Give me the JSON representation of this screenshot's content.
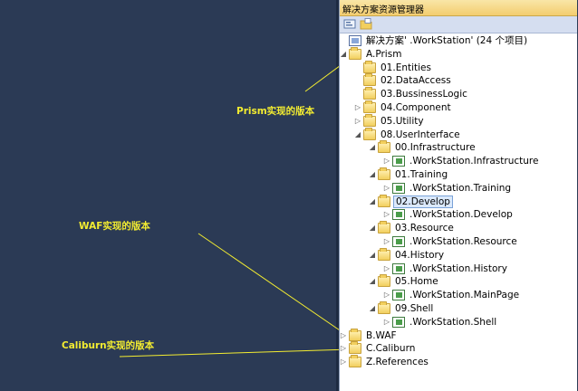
{
  "annotations": {
    "prism": "Prism实现的版本",
    "waf": "WAF实现的版本",
    "caliburn": "Caliburn实现的版本"
  },
  "panel": {
    "title": "解决方案资源管理器"
  },
  "toolbar": {
    "items": [
      "properties-icon",
      "show-all-files-icon"
    ]
  },
  "tree": [
    {
      "label": "解决方案'          .WorkStation' (24 个项目)",
      "icon": "solution-icon",
      "level": 0,
      "expander": ""
    },
    {
      "label": "A.Prism",
      "icon": "folder-icon",
      "level": 0,
      "expander": "expanded"
    },
    {
      "label": "01.Entities",
      "icon": "folder-icon",
      "level": 1,
      "expander": ""
    },
    {
      "label": "02.DataAccess",
      "icon": "folder-icon",
      "level": 1,
      "expander": ""
    },
    {
      "label": "03.BussinessLogic",
      "icon": "folder-icon",
      "level": 1,
      "expander": ""
    },
    {
      "label": "04.Component",
      "icon": "folder-icon",
      "level": 1,
      "expander": "collapsed"
    },
    {
      "label": "05.Utility",
      "icon": "folder-icon",
      "level": 1,
      "expander": "collapsed"
    },
    {
      "label": "08.UserInterface",
      "icon": "folder-icon",
      "level": 1,
      "expander": "expanded"
    },
    {
      "label": "00.Infrastructure",
      "icon": "folder-icon",
      "level": 2,
      "expander": "expanded"
    },
    {
      "label": ".WorkStation.Infrastructure",
      "icon": "project-icon",
      "level": 3,
      "expander": "collapsed"
    },
    {
      "label": "01.Training",
      "icon": "folder-icon",
      "level": 2,
      "expander": "expanded"
    },
    {
      "label": ".WorkStation.Training",
      "icon": "project-icon",
      "level": 3,
      "expander": "collapsed"
    },
    {
      "label": "02.Develop",
      "icon": "folder-icon",
      "level": 2,
      "expander": "expanded",
      "selected": true
    },
    {
      "label": ".WorkStation.Develop",
      "icon": "project-icon",
      "level": 3,
      "expander": "collapsed"
    },
    {
      "label": "03.Resource",
      "icon": "folder-icon",
      "level": 2,
      "expander": "expanded"
    },
    {
      "label": ".WorkStation.Resource",
      "icon": "project-icon",
      "level": 3,
      "expander": "collapsed"
    },
    {
      "label": "04.History",
      "icon": "folder-icon",
      "level": 2,
      "expander": "expanded"
    },
    {
      "label": ".WorkStation.History",
      "icon": "project-icon",
      "level": 3,
      "expander": "collapsed"
    },
    {
      "label": "05.Home",
      "icon": "folder-icon",
      "level": 2,
      "expander": "expanded"
    },
    {
      "label": ".WorkStation.MainPage",
      "icon": "project-icon",
      "level": 3,
      "expander": "collapsed"
    },
    {
      "label": "09.Shell",
      "icon": "folder-icon",
      "level": 2,
      "expander": "expanded"
    },
    {
      "label": ".WorkStation.Shell",
      "icon": "project-icon",
      "level": 3,
      "expander": "collapsed"
    },
    {
      "label": "B.WAF",
      "icon": "folder-icon",
      "level": 0,
      "expander": "collapsed"
    },
    {
      "label": "C.Caliburn",
      "icon": "folder-icon",
      "level": 0,
      "expander": "collapsed"
    },
    {
      "label": "Z.References",
      "icon": "folder-icon",
      "level": 0,
      "expander": "collapsed"
    }
  ],
  "colors": {
    "background": "#2b3a55",
    "annotation": "#f3ec31",
    "selection": "#dbe9fb"
  }
}
